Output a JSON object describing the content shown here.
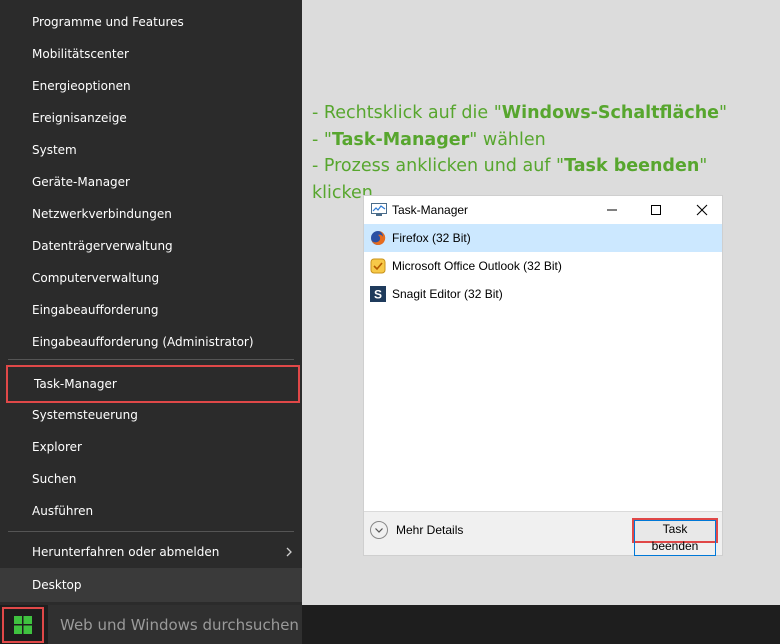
{
  "menu": {
    "items": [
      "Programme und Features",
      "Mobilitätscenter",
      "Energieoptionen",
      "Ereignisanzeige",
      "System",
      "Geräte-Manager",
      "Netzwerkverbindungen",
      "Datenträgerverwaltung",
      "Computerverwaltung",
      "Eingabeaufforderung",
      "Eingabeaufforderung (Administrator)"
    ],
    "task_manager": "Task-Manager",
    "items2": [
      "Systemsteuerung",
      "Explorer",
      "Suchen",
      "Ausführen"
    ],
    "shutdown": "Herunterfahren oder abmelden",
    "desktop": "Desktop"
  },
  "taskbar": {
    "search_placeholder": "Web und Windows durchsuchen"
  },
  "instructions": {
    "line1_prefix": "- Rechtsklick auf die \"",
    "line1_bold": "Windows-Schaltfläche",
    "line1_suffix": "\"",
    "line2_prefix": "- \"",
    "line2_bold": "Task-Manager",
    "line2_suffix": "\" wählen",
    "line3_prefix": "- Prozess anklicken und auf \"",
    "line3_bold": "Task beenden",
    "line3_suffix": "\" klicken"
  },
  "task_manager": {
    "title": "Task-Manager",
    "apps": [
      "Firefox (32 Bit)",
      "Microsoft Office Outlook (32 Bit)",
      "Snagit Editor (32 Bit)"
    ],
    "more_details": "Mehr Details",
    "end_task": "Task beenden"
  },
  "colors": {
    "accent_green": "#57a62e",
    "highlight_red": "#e04848",
    "menu_bg": "#2b2b2b",
    "selection": "#cce8ff"
  }
}
